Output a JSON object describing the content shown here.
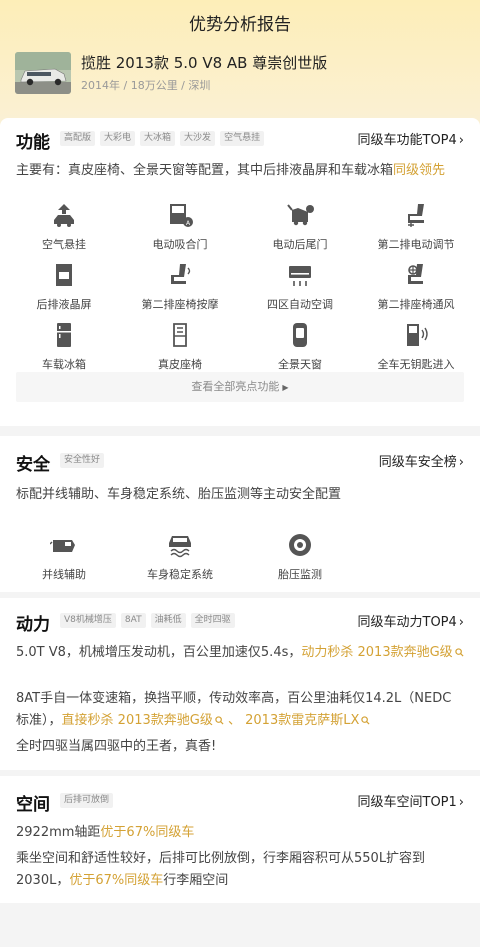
{
  "page": {
    "title": "优势分析报告"
  },
  "car": {
    "name": "揽胜 2013款 5.0 V8 AB 尊崇创世版",
    "meta": "2014年 / 18万公里 / 深圳"
  },
  "features": {
    "title": "功能",
    "tags": [
      "高配版",
      "大彩电",
      "大冰箱",
      "大沙发",
      "空气悬挂"
    ],
    "rank": "同级车功能TOP4",
    "summary_prefix": "主要有：真皮座椅、全景天窗等配置，其中后排液晶屏和车载冰箱",
    "summary_highlight": "同级领先",
    "items": [
      {
        "label": "空气悬挂",
        "icon": "air-suspension-icon"
      },
      {
        "label": "电动吸合门",
        "icon": "soft-close-door-icon"
      },
      {
        "label": "电动后尾门",
        "icon": "power-tailgate-icon"
      },
      {
        "label": "第二排电动调节",
        "icon": "power-seat-adjust-icon"
      },
      {
        "label": "后排液晶屏",
        "icon": "rear-screen-icon"
      },
      {
        "label": "第二排座椅按摩",
        "icon": "seat-massage-icon"
      },
      {
        "label": "四区自动空调",
        "icon": "climate-control-icon"
      },
      {
        "label": "第二排座椅通风",
        "icon": "seat-ventilation-icon"
      },
      {
        "label": "车载冰箱",
        "icon": "fridge-icon"
      },
      {
        "label": "真皮座椅",
        "icon": "leather-seat-icon"
      },
      {
        "label": "全景天窗",
        "icon": "sunroof-icon"
      },
      {
        "label": "全车无钥匙进入",
        "icon": "keyless-entry-icon"
      }
    ],
    "more_label": "查看全部亮点功能"
  },
  "safety": {
    "title": "安全",
    "tags": [
      "安全性好"
    ],
    "rank": "同级车安全榜",
    "summary": "标配并线辅助、车身稳定系统、胎压监测等主动安全配置",
    "items": [
      {
        "label": "并线辅助",
        "icon": "lane-assist-icon"
      },
      {
        "label": "车身稳定系统",
        "icon": "stability-control-icon"
      },
      {
        "label": "胎压监测",
        "icon": "tire-pressure-icon"
      }
    ]
  },
  "power": {
    "title": "动力",
    "tags": [
      "V8机械增压",
      "8AT",
      "油耗低",
      "全时四驱"
    ],
    "rank": "同级车动力TOP4",
    "p1_prefix": "5.0T V8，机械增压发动机，百公里加速仅5.4s，",
    "p1_highlight": "动力秒杀",
    "p1_link": "2013款奔驰G级",
    "p2_prefix": "8AT手自一体变速箱，换挡平顺，传动效率高，百公里油耗仅14.2L（NEDC标准），",
    "p2_highlight": "直接秒杀",
    "p2_link1": "2013款奔驰G级",
    "p2_sep": "、",
    "p2_link2": "2013款雷克萨斯LX",
    "p3": "全时四驱当属四驱中的王者，真香!"
  },
  "space": {
    "title": "空间",
    "tags": [
      "后排可放倒"
    ],
    "rank": "同级车空间TOP1",
    "p1_prefix": "2922mm轴距",
    "p1_highlight": "优于67%同级车",
    "p2_prefix": "乘坐空间和舒适性较好，后排可比例放倒，行李厢容积可从550L扩容到2030L，",
    "p2_highlight": "优于67%同级车",
    "p2_suffix": "行李厢空间"
  },
  "colors": {
    "accent": "#d4a235",
    "header_bg": "#fdeeb8"
  }
}
